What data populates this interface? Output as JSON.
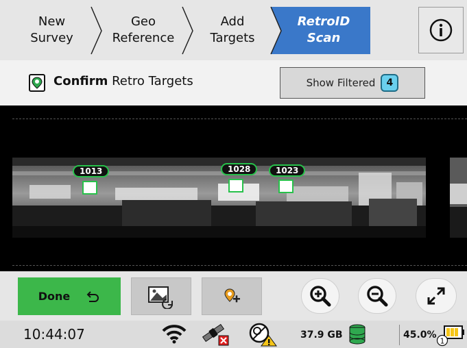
{
  "tabs": [
    {
      "line1": "New",
      "line2": "Survey"
    },
    {
      "line1": "Geo",
      "line2": "Reference"
    },
    {
      "line1": "Add",
      "line2": "Targets"
    },
    {
      "line1": "RetroID",
      "line2": "Scan"
    }
  ],
  "header": {
    "title_bold": "Confirm",
    "title_rest": " Retro Targets",
    "show_filtered_label": "Show Filtered",
    "filtered_count": "4"
  },
  "viewer": {
    "targets": [
      {
        "label": "1013"
      },
      {
        "label": "1028"
      },
      {
        "label": "1023"
      }
    ]
  },
  "toolbar": {
    "done_label": "Done"
  },
  "status": {
    "time": "10:44:07",
    "storage": "37.9 GB",
    "battery_percent": "45.0%",
    "battery_id": "1"
  },
  "icons": {
    "info": "info-icon",
    "wifi": "wifi-icon",
    "satellite_error": "satellite-error-icon",
    "instrument_warning": "instrument-warning-icon",
    "storage": "storage-icon",
    "battery": "battery-icon"
  },
  "colors": {
    "active_tab": "#3a78c9",
    "done_button": "#3cb74a",
    "target_outline": "#27c14a",
    "filter_badge": "#6ad0ee"
  }
}
